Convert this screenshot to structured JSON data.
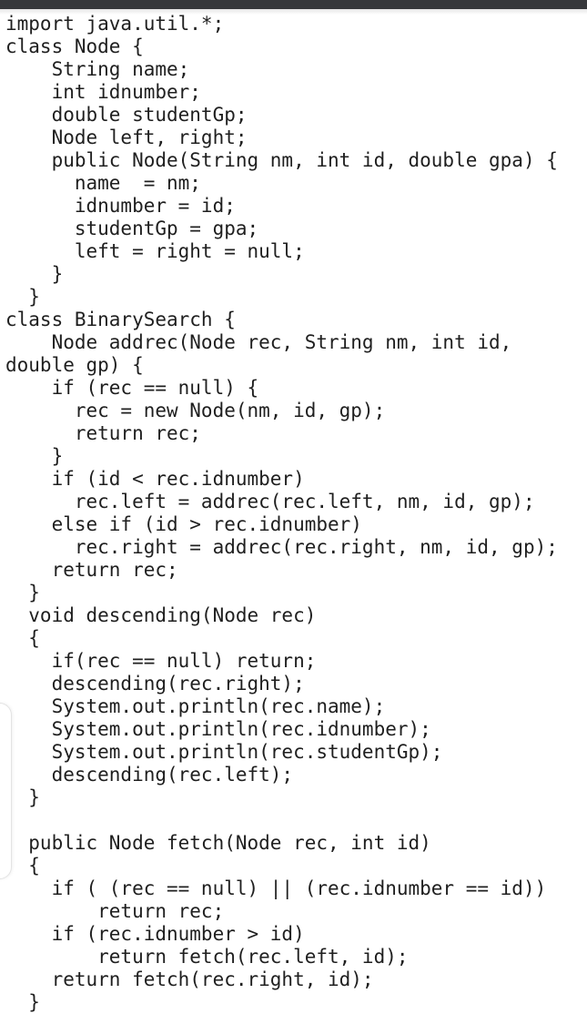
{
  "document": {
    "language": "java",
    "lines": [
      "import java.util.*;",
      "class Node {",
      "    String name;",
      "    int idnumber;",
      "    double studentGp;",
      "    Node left, right;",
      "    public Node(String nm, int id, double gpa) {",
      "      name  = nm;",
      "      idnumber = id;",
      "      studentGp = gpa;",
      "      left = right = null;",
      "    }",
      "  }",
      "class BinarySearch {",
      "    Node addrec(Node rec, String nm, int id,",
      "double gp) {",
      "    if (rec == null) {",
      "      rec = new Node(nm, id, gp);",
      "      return rec;",
      "    }",
      "    if (id < rec.idnumber)",
      "      rec.left = addrec(rec.left, nm, id, gp);",
      "    else if (id > rec.idnumber)",
      "      rec.right = addrec(rec.right, nm, id, gp);",
      "    return rec;",
      "  }",
      "  void descending(Node rec)",
      "  {",
      "    if(rec == null) return;",
      "    descending(rec.right);",
      "    System.out.println(rec.name);",
      "    System.out.println(rec.idnumber);",
      "    System.out.println(rec.studentGp);",
      "    descending(rec.left);",
      "  }",
      "",
      "  public Node fetch(Node rec, int id)",
      "  {",
      "    if ( (rec == null) || (rec.idnumber == id))",
      "        return rec;",
      "    if (rec.idnumber > id)",
      "        return fetch(rec.left, id);",
      "    return fetch(rec.right, id);",
      "  }"
    ]
  }
}
